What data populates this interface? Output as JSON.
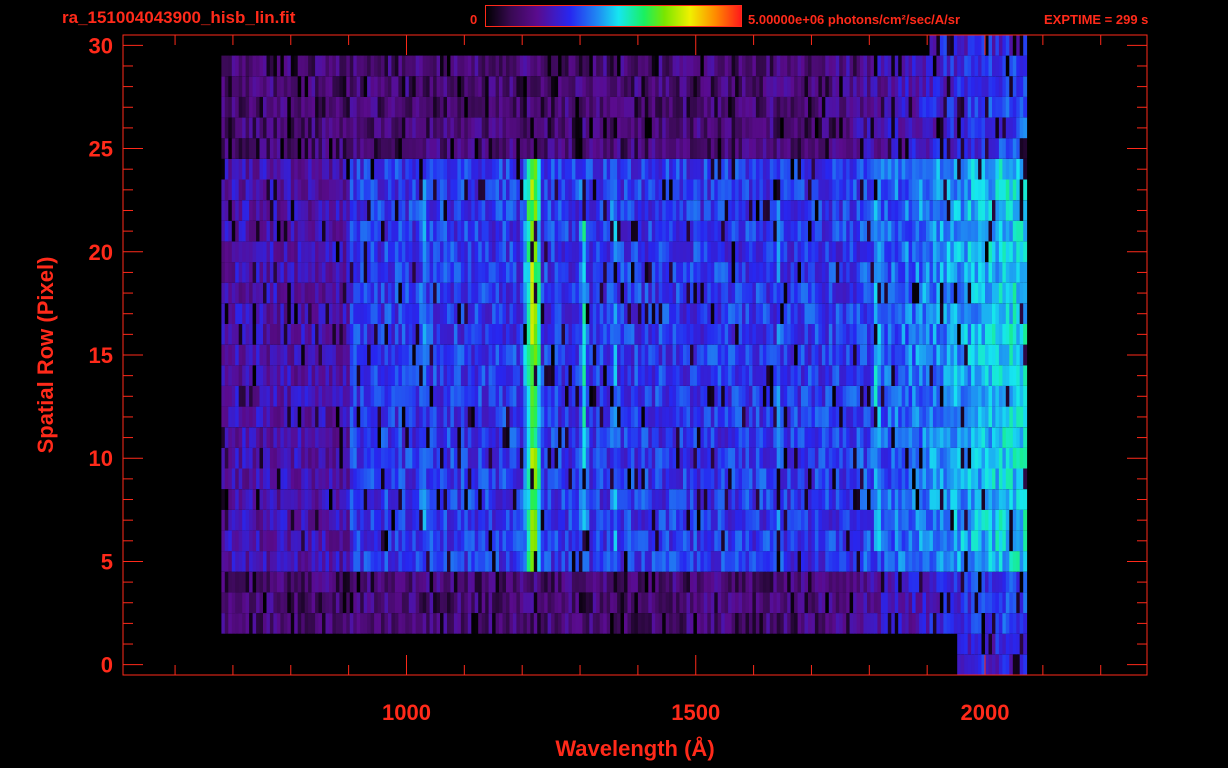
{
  "header": {
    "title": "ra_151004043900_hisb_lin.fit",
    "colorbar_min": "0",
    "colorbar_max": "5.00000e+06 photons/cm²/sec/A/sr",
    "exptime": "EXPTIME = 299 s"
  },
  "colors": {
    "text": "#ff2a1a",
    "background": "#000000",
    "axis": "#ff2a1a"
  },
  "chart_data": {
    "type": "heatmap",
    "title": "ra_151004043900_hisb_lin.fit",
    "xlabel": "Wavelength (Å)",
    "ylabel": "Spatial Row (Pixel)",
    "xlim": [
      510,
      2280
    ],
    "ylim": [
      -0.5,
      30.5
    ],
    "x_ticks": [
      1000,
      1500,
      2000
    ],
    "y_ticks": [
      0,
      5,
      10,
      15,
      20,
      25,
      30
    ],
    "colorbar_range": [
      0,
      5000000
    ],
    "colorbar_unit": "photons/cm²/sec/A/sr",
    "exposure_time_s": 299,
    "data_extent": {
      "wavelength_range": [
        680,
        2070
      ],
      "row_range": [
        0,
        30
      ],
      "bright_rows": [
        5,
        24
      ]
    },
    "emission_lines": [
      {
        "wavelength": 1026,
        "rows": [
          7,
          23
        ],
        "level": 0.45
      },
      {
        "wavelength": 1216,
        "rows": [
          5,
          24
        ],
        "level": 0.74
      },
      {
        "wavelength": 1304,
        "rows": [
          6,
          23
        ],
        "level": 0.52
      },
      {
        "wavelength": 1356,
        "rows": [
          6,
          23
        ],
        "level": 0.47
      },
      {
        "wavelength": 1640,
        "rows": [
          7,
          22
        ],
        "level": 0.4
      },
      {
        "wavelength": 1810,
        "rows": [
          6,
          23
        ],
        "level": 0.53
      }
    ]
  }
}
